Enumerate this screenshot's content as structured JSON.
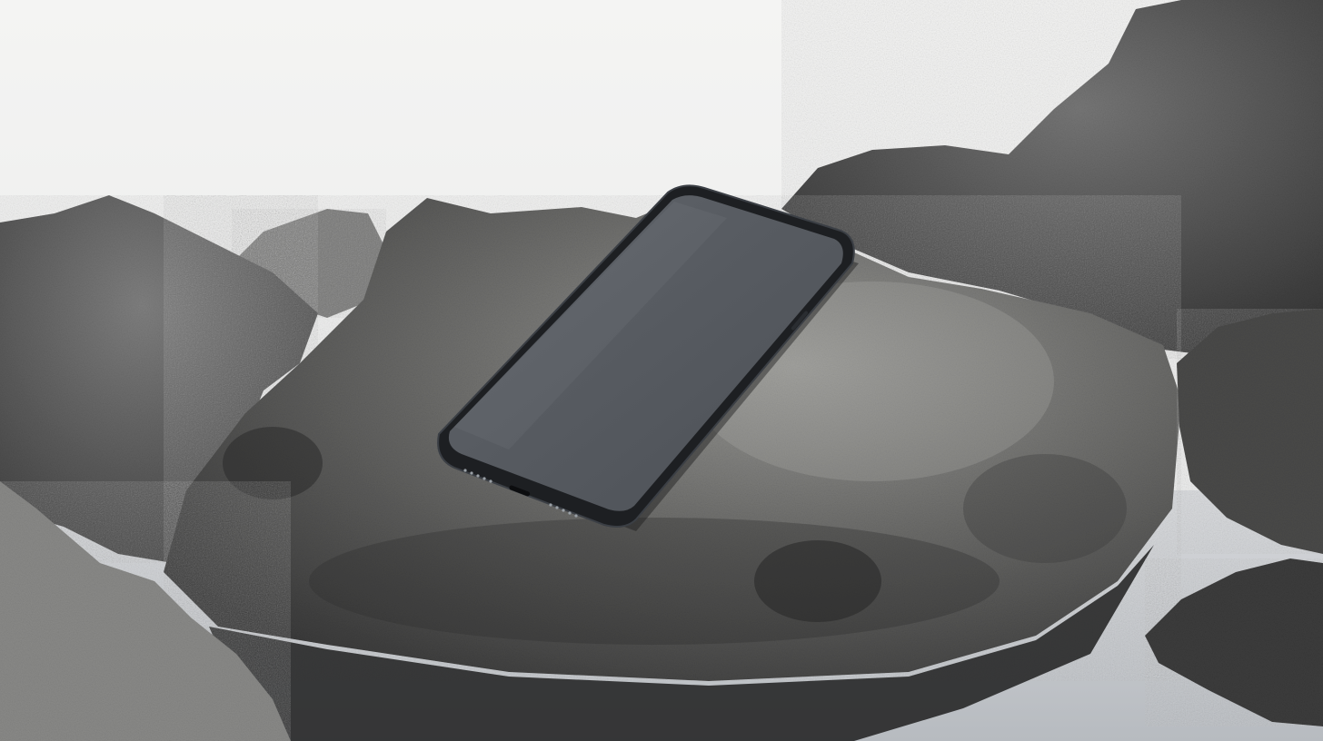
{
  "scene": {
    "subject": "smartphone-on-rock",
    "screen_state": "blank",
    "colors": {
      "sky": "#f1f1f0",
      "rock_light": "#8c8c8a",
      "rock_mid": "#5a5a58",
      "rock_dark": "#2c2c2c",
      "water": "#c9ccd0",
      "phone_frame": "#1d1f22",
      "phone_screen": "#55595f"
    }
  }
}
